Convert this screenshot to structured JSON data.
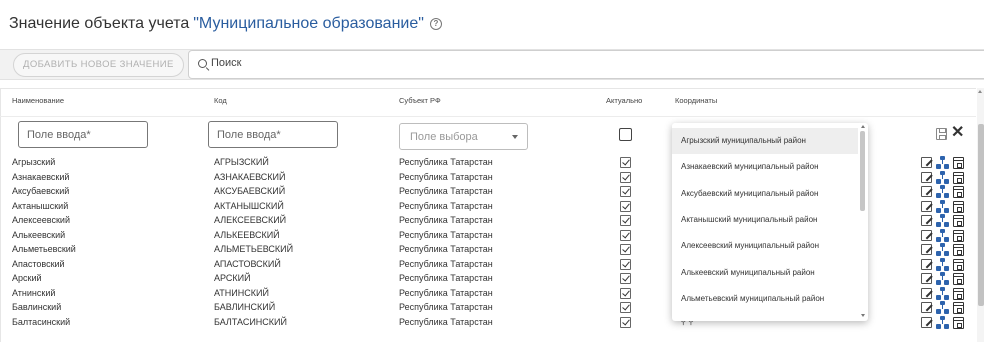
{
  "header": {
    "title_prefix": "Значение объекта учета",
    "title_entity": "\"Муниципальное образование\"",
    "help_glyph": "?"
  },
  "toolbar": {
    "add_button_label": "ДОБАВИТЬ НОВОЕ ЗНАЧЕНИЕ",
    "search_placeholder": "Поиск"
  },
  "table": {
    "columns": [
      "Наименование",
      "Код",
      "Субъект РФ",
      "Актуально",
      "Координаты"
    ],
    "new_row": {
      "name_placeholder": "Поле ввода*",
      "code_placeholder": "Поле ввода*",
      "subject_placeholder": "Поле выбора"
    },
    "rows": [
      {
        "name": "Агрызский",
        "code": "АГРЫЗСКИЙ",
        "subject": "Республика Татарстан",
        "actual": true
      },
      {
        "name": "Азнакаевский",
        "code": "АЗНАКАЕВСКИЙ",
        "subject": "Республика Татарстан",
        "actual": true
      },
      {
        "name": "Аксубаевский",
        "code": "АКСУБАЕВСКИЙ",
        "subject": "Республика Татарстан",
        "actual": true
      },
      {
        "name": "Актанышский",
        "code": "АКТАНЫШСКИЙ",
        "subject": "Республика Татарстан",
        "actual": true
      },
      {
        "name": "Алексеевский",
        "code": "АЛЕКСЕЕВСКИЙ",
        "subject": "Республика Татарстан",
        "actual": true
      },
      {
        "name": "Алькеевский",
        "code": "АЛЬКЕЕВСКИЙ",
        "subject": "Республика Татарстан",
        "actual": true
      },
      {
        "name": "Альметьевский",
        "code": "АЛЬМЕТЬЕВСКИЙ",
        "subject": "Республика Татарстан",
        "actual": true
      },
      {
        "name": "Апастовский",
        "code": "АПАСТОВСКИЙ",
        "subject": "Республика Татарстан",
        "actual": true
      },
      {
        "name": "Арский",
        "code": "АРСКИЙ",
        "subject": "Республика Татарстан",
        "actual": true
      },
      {
        "name": "Атнинский",
        "code": "АТНИНСКИЙ",
        "subject": "Республика Татарстан",
        "actual": true
      },
      {
        "name": "Бавлинский",
        "code": "БАВЛИНСКИЙ",
        "subject": "Республика Татарстан",
        "actual": true
      },
      {
        "name": "Балтасинский",
        "code": "БАЛТАСИНСКИЙ",
        "subject": "Республика Татарстан",
        "actual": true
      }
    ]
  },
  "dropdown": {
    "items": [
      "Агрызский муниципальный район",
      "Азнакаевский муниципальный район",
      "Аксубаевский муниципальный район",
      "Актанышский муниципальный район",
      "Алексеевский муниципальный район",
      "Алькеевский муниципальный район",
      "Альметьевский муниципальный район"
    ],
    "highlighted_index": 0
  },
  "colors": {
    "accent": "#2a5d9f",
    "hierarchy_icon": "#2d63ad"
  }
}
